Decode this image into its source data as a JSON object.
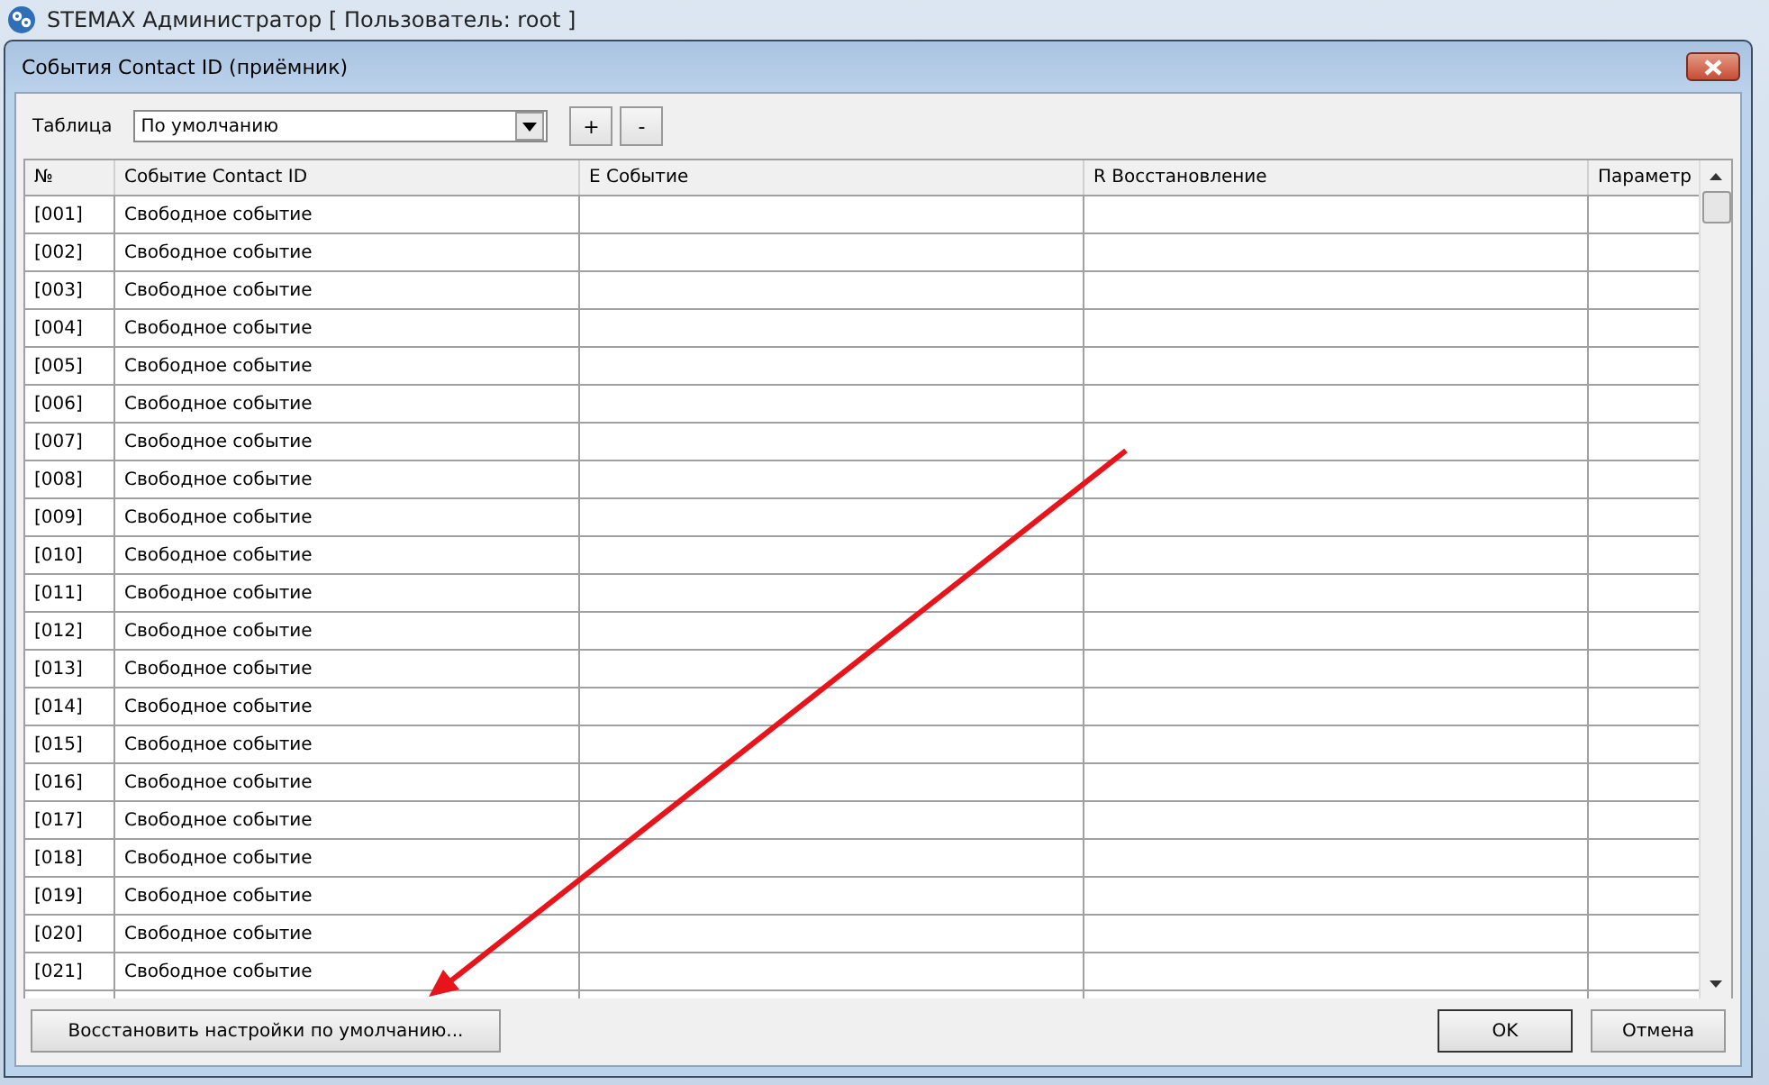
{
  "app_title": "STEMAX Администратор [ Пользователь: root ]",
  "dialog": {
    "title": "События Contact ID (приёмник)",
    "table_label": "Таблица",
    "table_select": {
      "value": "По умолчанию"
    },
    "toolbar_buttons": [
      "+",
      "-"
    ],
    "grid": {
      "columns": [
        "№",
        "Событие Contact ID",
        "E Событие",
        "R Восстановление",
        "Параметр"
      ],
      "rows": [
        [
          "[001]",
          "Свободное событие"
        ],
        [
          "[002]",
          "Свободное событие"
        ],
        [
          "[003]",
          "Свободное событие"
        ],
        [
          "[004]",
          "Свободное событие"
        ],
        [
          "[005]",
          "Свободное событие"
        ],
        [
          "[006]",
          "Свободное событие"
        ],
        [
          "[007]",
          "Свободное событие"
        ],
        [
          "[008]",
          "Свободное событие"
        ],
        [
          "[009]",
          "Свободное событие"
        ],
        [
          "[010]",
          "Свободное событие"
        ],
        [
          "[011]",
          "Свободное событие"
        ],
        [
          "[012]",
          "Свободное событие"
        ],
        [
          "[013]",
          "Свободное событие"
        ],
        [
          "[014]",
          "Свободное событие"
        ],
        [
          "[015]",
          "Свободное событие"
        ],
        [
          "[016]",
          "Свободное событие"
        ],
        [
          "[017]",
          "Свободное событие"
        ],
        [
          "[018]",
          "Свободное событие"
        ],
        [
          "[019]",
          "Свободное событие"
        ],
        [
          "[020]",
          "Свободное событие"
        ],
        [
          "[021]",
          "Свободное событие"
        ]
      ]
    },
    "restore_button": "Восстановить настройки по умолчанию...",
    "buttons": [
      {
        "label": "OK",
        "default": true
      },
      {
        "label": "Отмена",
        "default": false
      }
    ]
  }
}
